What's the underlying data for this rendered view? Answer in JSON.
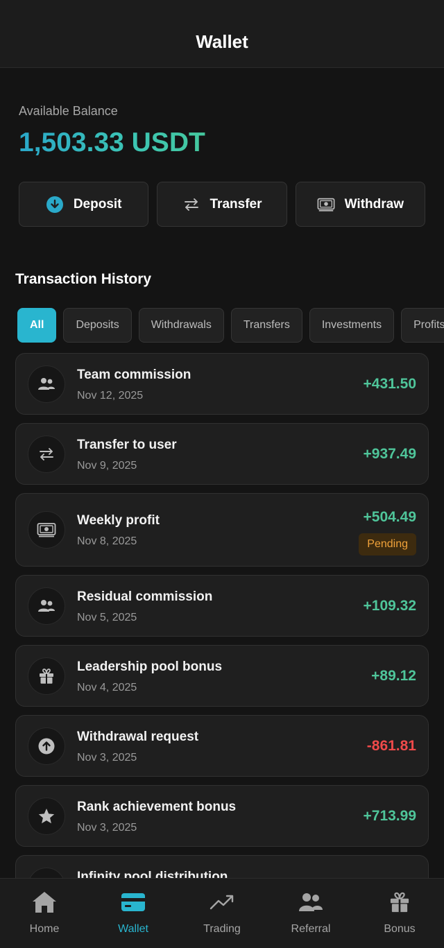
{
  "header": {
    "title": "Wallet"
  },
  "balance": {
    "label": "Available Balance",
    "value": "1,503.33 USDT"
  },
  "actions": [
    {
      "label": "Deposit",
      "icon": "download-circle-icon"
    },
    {
      "label": "Transfer",
      "icon": "arrows-exchange-icon"
    },
    {
      "label": "Withdraw",
      "icon": "cash-icon"
    }
  ],
  "history": {
    "title": "Transaction History",
    "filters": [
      "All",
      "Deposits",
      "Withdrawals",
      "Transfers",
      "Investments",
      "Profits"
    ],
    "active_filter": "All",
    "transactions": [
      {
        "title": "Team commission",
        "date": "Nov 12, 2025",
        "amount": "+431.50",
        "icon": "users-icon"
      },
      {
        "title": "Transfer to user",
        "date": "Nov 9, 2025",
        "amount": "+937.49",
        "icon": "arrows-exchange-icon"
      },
      {
        "title": "Weekly profit",
        "date": "Nov 8, 2025",
        "amount": "+504.49",
        "status": "Pending",
        "icon": "cash-icon"
      },
      {
        "title": "Residual commission",
        "date": "Nov 5, 2025",
        "amount": "+109.32",
        "icon": "users-icon"
      },
      {
        "title": "Leadership pool bonus",
        "date": "Nov 4, 2025",
        "amount": "+89.12",
        "icon": "gift-icon"
      },
      {
        "title": "Withdrawal request",
        "date": "Nov 3, 2025",
        "amount": "-861.81",
        "icon": "arrow-up-circle-icon"
      },
      {
        "title": "Rank achievement bonus",
        "date": "Nov 3, 2025",
        "amount": "+713.99",
        "icon": "star-icon"
      },
      {
        "title": "Infinity pool distribution",
        "date": "",
        "amount": "",
        "icon": "infinity-icon"
      }
    ]
  },
  "nav": {
    "items": [
      {
        "label": "Home",
        "icon": "home-icon"
      },
      {
        "label": "Wallet",
        "icon": "wallet-icon"
      },
      {
        "label": "Trading",
        "icon": "trending-up-icon"
      },
      {
        "label": "Referral",
        "icon": "users-icon"
      },
      {
        "label": "Bonus",
        "icon": "gift-icon"
      }
    ],
    "active": "Wallet"
  },
  "colors": {
    "accent": "#29b5cf",
    "positive": "#4fc59a",
    "negative": "#ef4a4a",
    "pending": "#f0a23a",
    "background": "#141414"
  }
}
